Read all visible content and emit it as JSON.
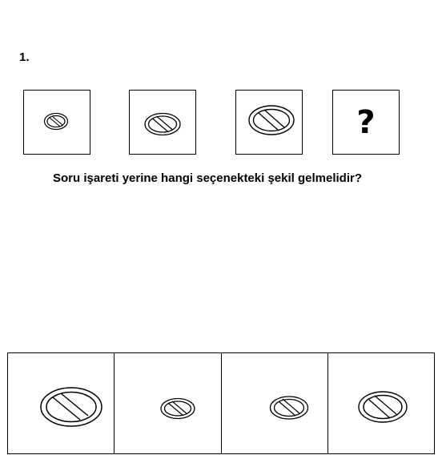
{
  "question": {
    "number": "1.",
    "prompt": "Soru işareti yerine hangi seçenekteki şekil gelmelidir?"
  },
  "sequence": [
    {
      "icon": "no-entry-symbol",
      "scale": "smallest"
    },
    {
      "icon": "no-entry-symbol",
      "scale": "small"
    },
    {
      "icon": "no-entry-symbol",
      "scale": "medium"
    },
    {
      "icon": "question-mark",
      "text": "?"
    }
  ],
  "options": [
    {
      "icon": "no-entry-symbol",
      "scale": "largest"
    },
    {
      "icon": "no-entry-symbol",
      "scale": "small"
    },
    {
      "icon": "no-entry-symbol",
      "scale": "small"
    },
    {
      "icon": "no-entry-symbol",
      "scale": "medium"
    }
  ]
}
